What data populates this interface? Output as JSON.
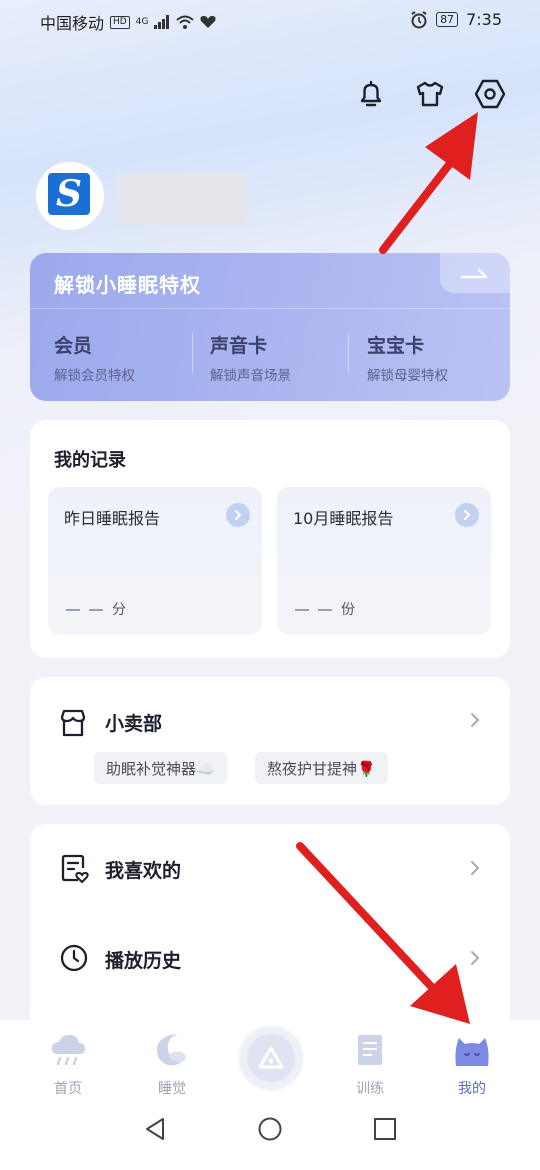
{
  "status_bar": {
    "carrier": "中国移动",
    "hd": "HD",
    "network": "4G",
    "battery": "87",
    "time": "7:35"
  },
  "top_icons": [
    "bell-icon",
    "shirt-icon",
    "settings-icon"
  ],
  "vip": {
    "title": "解锁小睡眠特权",
    "items": [
      {
        "title": "会员",
        "sub": "解锁会员特权"
      },
      {
        "title": "声音卡",
        "sub": "解锁声音场景"
      },
      {
        "title": "宝宝卡",
        "sub": "解锁母婴特权"
      }
    ]
  },
  "records": {
    "title": "我的记录",
    "reports": [
      {
        "title": "昨日睡眠报告",
        "unit": "分"
      },
      {
        "title": "10月睡眠报告",
        "unit": "份"
      }
    ]
  },
  "shop": {
    "title": "小卖部",
    "tags": [
      "助眠补觉神器☁️",
      "熬夜护甘提神🌹"
    ]
  },
  "menu": [
    {
      "label": "我喜欢的"
    },
    {
      "label": "播放历史"
    }
  ],
  "nav": {
    "items": [
      {
        "label": "首页"
      },
      {
        "label": "睡觉"
      },
      {
        "label": ""
      },
      {
        "label": "训练"
      },
      {
        "label": "我的"
      }
    ]
  },
  "colors": {
    "accent": "#5c6bcf",
    "vip_bg": "#a9b4f0",
    "arrow": "#e01f1f"
  }
}
